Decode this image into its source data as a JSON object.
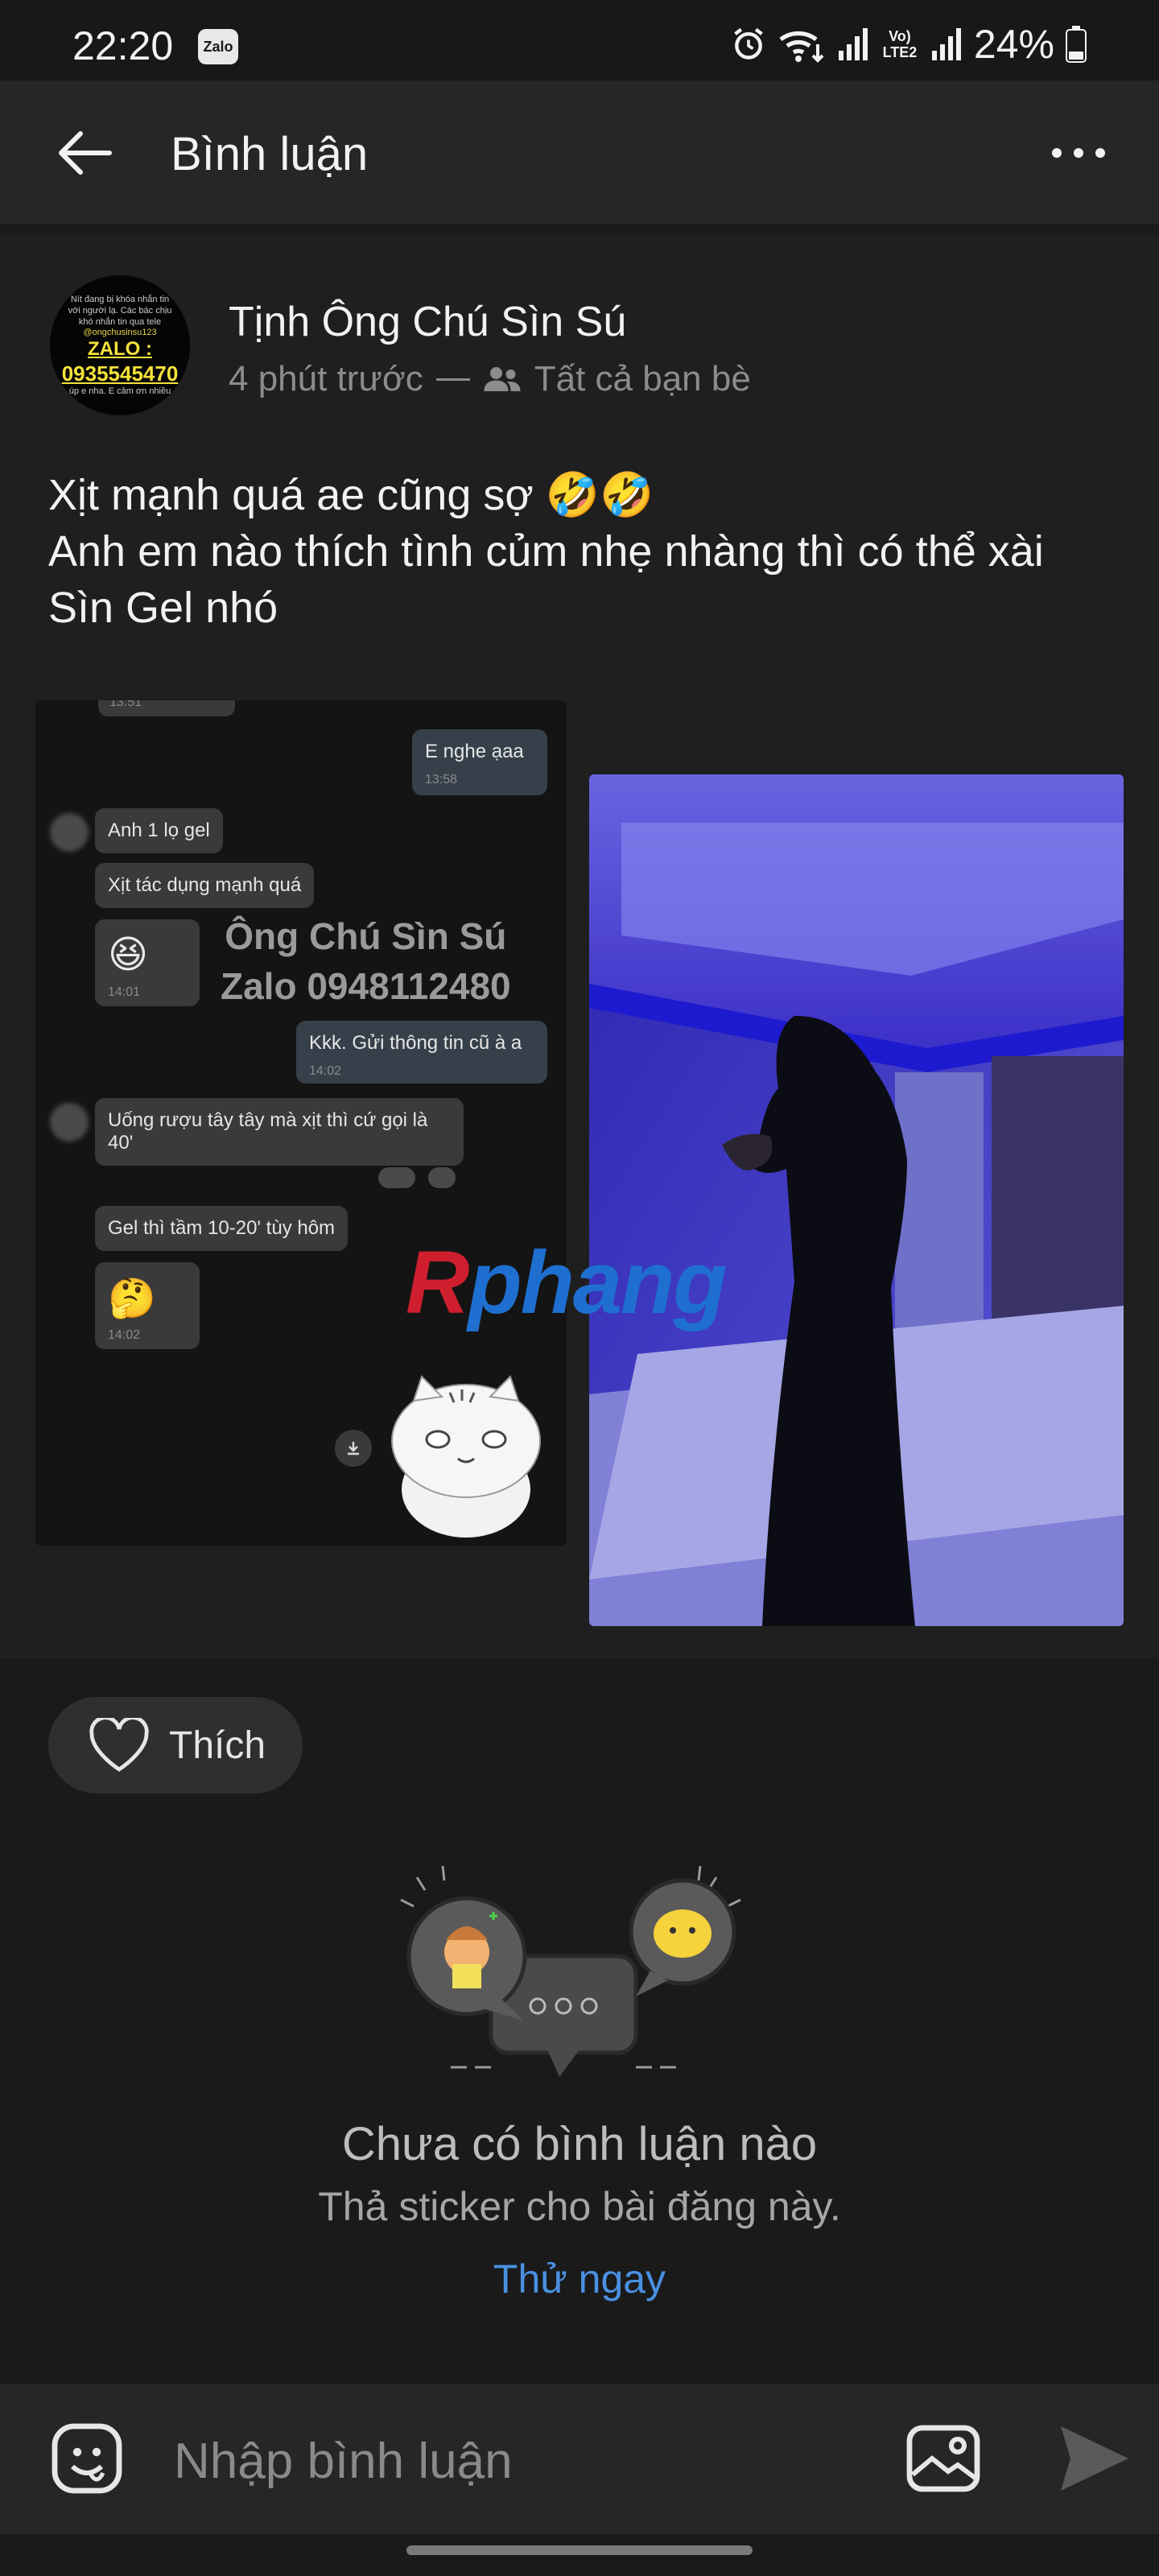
{
  "status_bar": {
    "time": "22:20",
    "app_badge": "Zalo",
    "volte_label": "Vo) LTE2",
    "battery": "24%",
    "icons": [
      "alarm-icon",
      "wifi-icon",
      "signal-icon",
      "volte-icon",
      "signal-icon",
      "battery-icon"
    ]
  },
  "header": {
    "title": "Bình luận",
    "back_icon": "arrow-left-icon",
    "more_icon": "more-horizontal-icon"
  },
  "post": {
    "avatar": {
      "small_text": "Nít đang bị khóa nhắn tin với người lạ. Các bác chịu khó nhắn tin qua tele",
      "handle": "@ongchusinsu123",
      "zalo_label": "ZALO :",
      "phone": "0935545470",
      "footer": "úp e nha. E cảm ơn nhiều"
    },
    "author": "Tịnh Ông Chú Sìn Sú",
    "time": "4 phút trước",
    "audience": "Tất cả bạn bè",
    "text_line1": "Xịt mạnh quá ae cũng sợ 🤣🤣",
    "text_line2": "Anh em nào thích tình củm nhẹ nhàng thì có thể xài",
    "text_line3": "Sìn Gel nhó",
    "chat_screenshot": {
      "top_time": "13:51",
      "msg_right_1": "E nghe ạaa",
      "msg_right_1_time": "13:58",
      "msg_left_1": "Anh 1 lọ gel",
      "msg_left_2": "Xịt tác dụng mạnh quá",
      "emoji_time_1": "14:01",
      "msg_right_2": "Kkk. Gửi thông tin cũ à a",
      "msg_right_2_time": "14:02",
      "msg_left_3_line1": "Uống rượu tây tây mà xịt thì cứ gọi là",
      "msg_left_3_line2": "40'",
      "msg_left_4": "Gel thì tầm 10-20' tùy hôm",
      "emoji_time_2": "14:02",
      "watermark_line1": "Ông Chú Sìn Sú",
      "watermark_line2": "Zalo 0948112480"
    },
    "overlay_logo_r": "R",
    "overlay_logo_rest": "phang"
  },
  "actions": {
    "like_label": "Thích"
  },
  "comments_empty": {
    "title": "Chưa có bình luận nào",
    "subtitle": "Thả sticker cho bài đăng này.",
    "cta": "Thử ngay"
  },
  "composer": {
    "placeholder": "Nhập bình luận"
  }
}
